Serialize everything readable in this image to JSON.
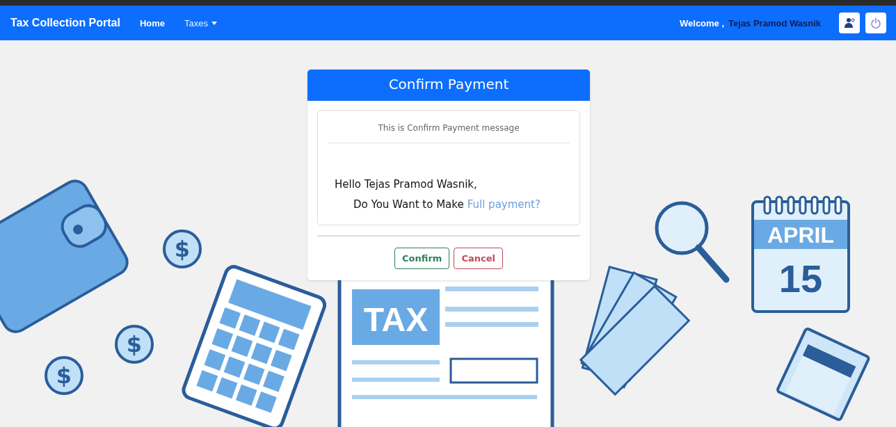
{
  "navbar": {
    "brand": "Tax Collection Portal",
    "links": [
      {
        "label": "Home",
        "kind": "link"
      },
      {
        "label": "Taxes",
        "kind": "dropdown"
      }
    ],
    "welcome": "Welcome ,",
    "user": "Tejas Pramod Wasnik"
  },
  "modal": {
    "title": "Confirm Payment",
    "message": "This is Confirm Payment message",
    "greeting": "Hello Tejas Pramod Wasnik,",
    "question": "Do You Want to Make",
    "link": "Full payment?",
    "buttons": [
      {
        "label": "Confirm",
        "kind": "confirm"
      },
      {
        "label": "Cancel",
        "kind": "cancel"
      }
    ]
  },
  "illustration": {
    "coins": [
      "$",
      "$",
      "$"
    ],
    "document_label": "TAX",
    "calendar_month": "APRIL",
    "calendar_day": "15"
  }
}
